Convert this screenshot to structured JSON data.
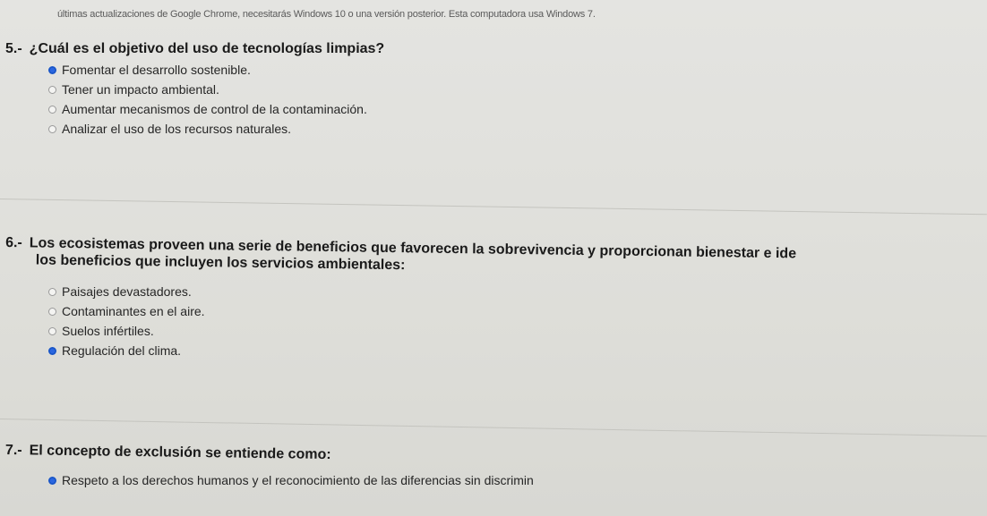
{
  "notice": "últimas actualizaciones de Google Chrome, necesitarás Windows 10 o una versión posterior. Esta computadora usa Windows 7.",
  "questions": [
    {
      "number": "5.-",
      "text": "¿Cuál es el objetivo del uso de tecnologías limpias?",
      "text_line2": "",
      "options": [
        {
          "label": "Fomentar el desarrollo sostenible.",
          "checked": true
        },
        {
          "label": "Tener un impacto ambiental.",
          "checked": false
        },
        {
          "label": "Aumentar mecanismos de control de la contaminación.",
          "checked": false
        },
        {
          "label": "Analizar el uso de los recursos naturales.",
          "checked": false
        }
      ]
    },
    {
      "number": "6.-",
      "text": "Los ecosistemas proveen una serie de beneficios que favorecen la sobrevivencia y proporcionan bienestar e ide",
      "text_line2": "los beneficios que incluyen los servicios ambientales:",
      "options": [
        {
          "label": "Paisajes devastadores.",
          "checked": false
        },
        {
          "label": "Contaminantes en el aire.",
          "checked": false
        },
        {
          "label": "Suelos infértiles.",
          "checked": false
        },
        {
          "label": "Regulación del clima.",
          "checked": true
        }
      ]
    },
    {
      "number": "7.-",
      "text": "El concepto de exclusión se entiende como:",
      "text_line2": "",
      "options": [
        {
          "label": "Respeto a los derechos humanos y el reconocimiento de las diferencias sin discrimin",
          "checked": true
        }
      ]
    }
  ],
  "colors": {
    "radio_checked": "#1a56c8",
    "background": "#e0e0dc"
  }
}
